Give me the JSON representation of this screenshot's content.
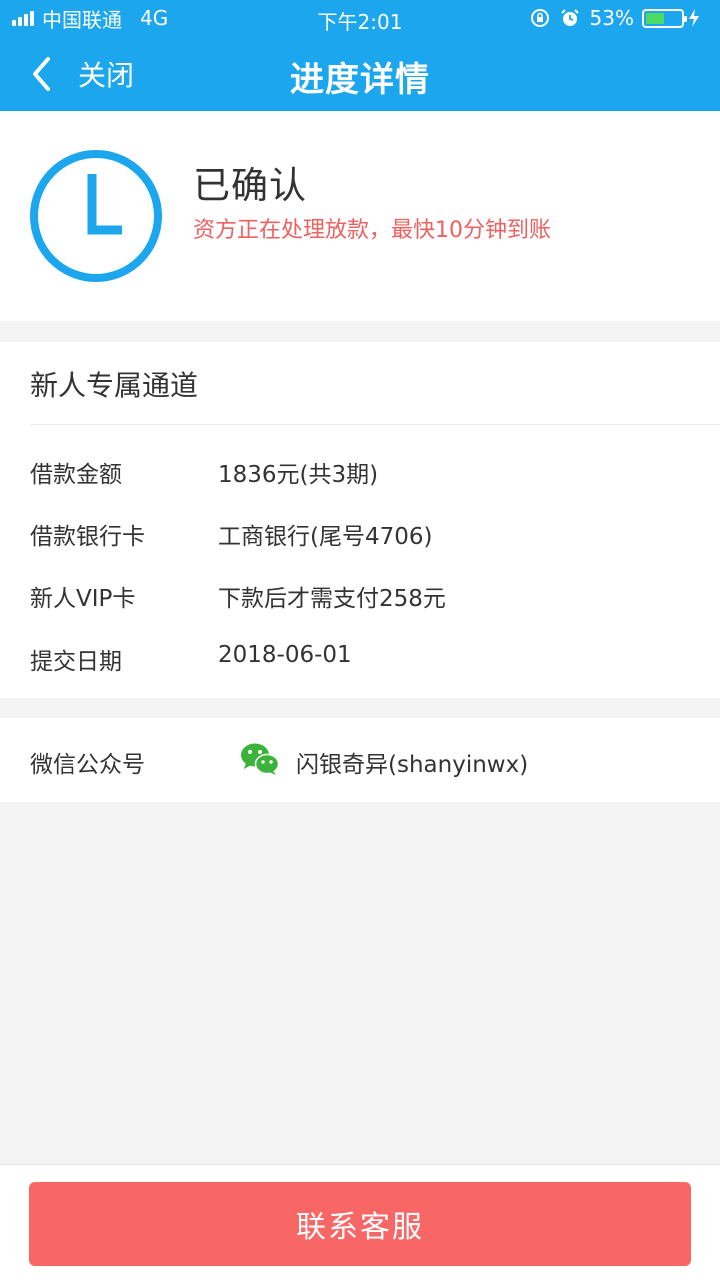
{
  "status_bar": {
    "carrier": "中国联通",
    "network": "4G",
    "time": "下午2:01",
    "battery_percent_text": "53%",
    "battery_level": 0.53
  },
  "nav": {
    "back_label": "关闭",
    "title": "进度详情"
  },
  "status": {
    "title": "已确认",
    "description": "资方正在处理放款，最快10分钟到账",
    "accent_color": "#1ca6ee",
    "alert_color": "#f0605f"
  },
  "info": {
    "header": "新人专属通道",
    "rows": [
      {
        "label": "借款金额",
        "value": "1836元(共3期)"
      },
      {
        "label": "借款银行卡",
        "value": "工商银行(尾号4706)"
      },
      {
        "label": "新人VIP卡",
        "value": "下款后才需支付258元"
      },
      {
        "label": "提交日期",
        "value": "2018-06-01"
      }
    ]
  },
  "wechat": {
    "label": "微信公众号",
    "icon": "wechat-icon",
    "value": "闪银奇异(shanyinwx)"
  },
  "footer": {
    "contact_label": "联系客服",
    "button_color": "#f96666"
  }
}
